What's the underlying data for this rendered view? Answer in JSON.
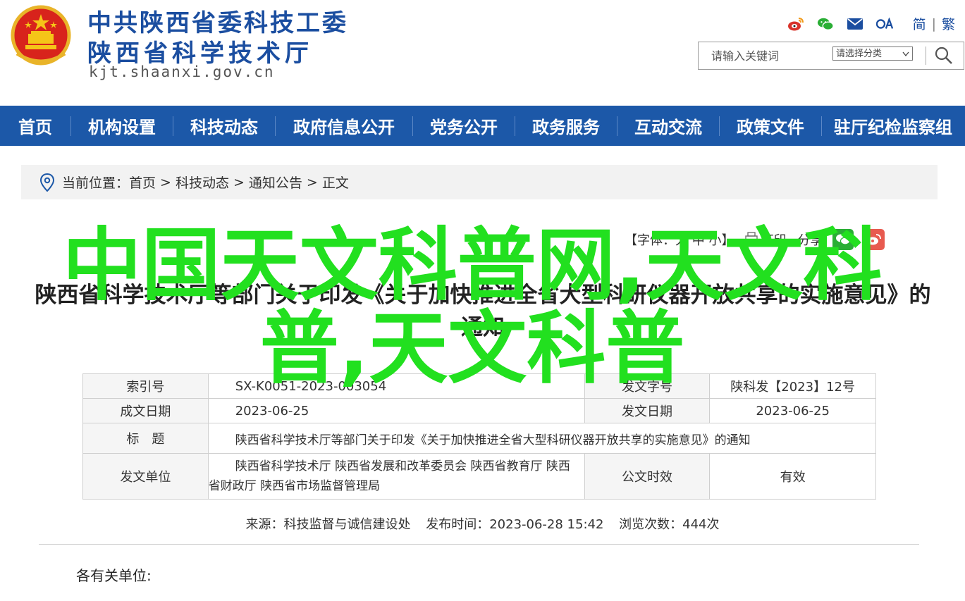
{
  "header": {
    "org_line1": "中共陕西省委科技工委",
    "org_line2": "陕西省科学技术厅",
    "domain": "kjt.shaanxi.gov.cn",
    "lang_simplified": "简",
    "lang_divider": "|",
    "lang_traditional": "繁",
    "search_placeholder": "请输入关键词",
    "category_select": "请选择分类"
  },
  "nav": {
    "items": [
      "首页",
      "机构设置",
      "科技动态",
      "政府信息公开",
      "党务公开",
      "政务服务",
      "互动交流",
      "政策文件",
      "驻厅纪检监察组"
    ]
  },
  "breadcrumb": {
    "label": "当前位置：",
    "items": [
      "首页",
      "科技动态",
      "通知公告",
      "正文"
    ],
    "separator": ">"
  },
  "tools": {
    "font_size": "【字体：大 中 小】",
    "print": "打印",
    "share": "分享"
  },
  "article": {
    "title": "陕西省科学技术厅等部门关于印发《关于加快推进全省大型科研仪器开放共享的实施意见》的通知",
    "info": {
      "index_label": "索引号",
      "index_value": "SX-K0051-2023-003054",
      "docno_label": "发文字号",
      "docno_value": "陕科发【2023】12号",
      "written_label": "成文日期",
      "written_value": "2023-06-25",
      "issued_label": "发文日期",
      "issued_value": "2023-06-25",
      "subject_label": "标　题",
      "subject_value": "陕西省科学技术厅等部门关于印发《关于加快推进全省大型科研仪器开放共享的实施意见》的通知",
      "issuer_label": "发文单位",
      "issuer_value_line1": "陕西省科学技术厅 陕西省发展和改革委员会 陕西省教育厅 陕西",
      "issuer_value_line2": "省财政厅 陕西省市场监督管理局",
      "validity_label": "公文时效",
      "validity_value": "有效"
    },
    "meta": {
      "source": "来源：科技监督与诚信建设处",
      "published": "发布时间：2023-06-28 15:42",
      "views": "浏览次数：444次"
    },
    "salutation": "各有关单位:"
  },
  "watermark": {
    "line1": "中国天文科普网,天文科",
    "line2": "普,天文科普"
  },
  "colors": {
    "brand_blue": "#1c58a8",
    "watermark_green": "#22e01f"
  }
}
